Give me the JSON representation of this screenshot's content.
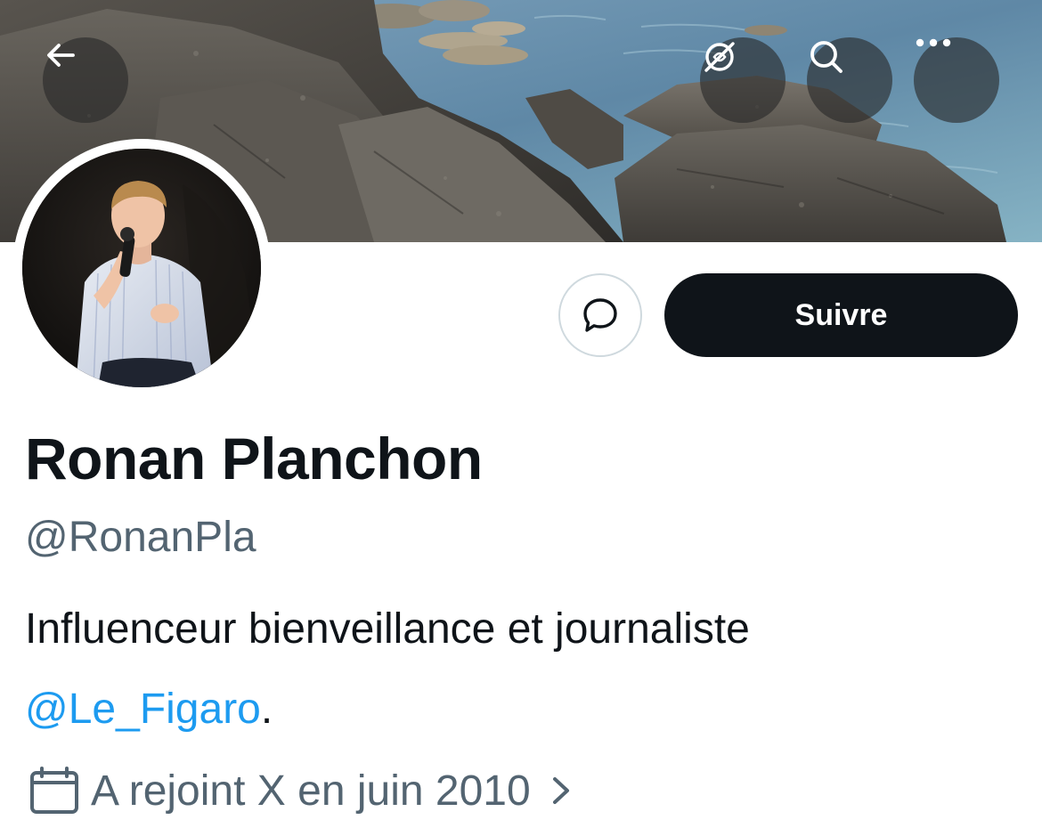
{
  "header": {
    "back_icon": "arrow-left-icon",
    "translate_icon": "no-translate-icon",
    "search_icon": "search-icon",
    "more_icon": "more-horizontal-icon"
  },
  "profile": {
    "display_name": "Ronan Planchon",
    "handle": "@RonanPla",
    "bio_text": "Influenceur bienveillance et journaliste",
    "bio_mention": "@Le_Figaro",
    "bio_suffix": ".",
    "joined_text": "A rejoint X en juin 2010"
  },
  "actions": {
    "follow_label": "Suivre",
    "message_icon": "message-bubble-icon"
  },
  "colors": {
    "follow_button_bg": "#0f1419",
    "mention": "#1d9bf0",
    "secondary_text": "#536471",
    "primary_text": "#0f1419"
  }
}
